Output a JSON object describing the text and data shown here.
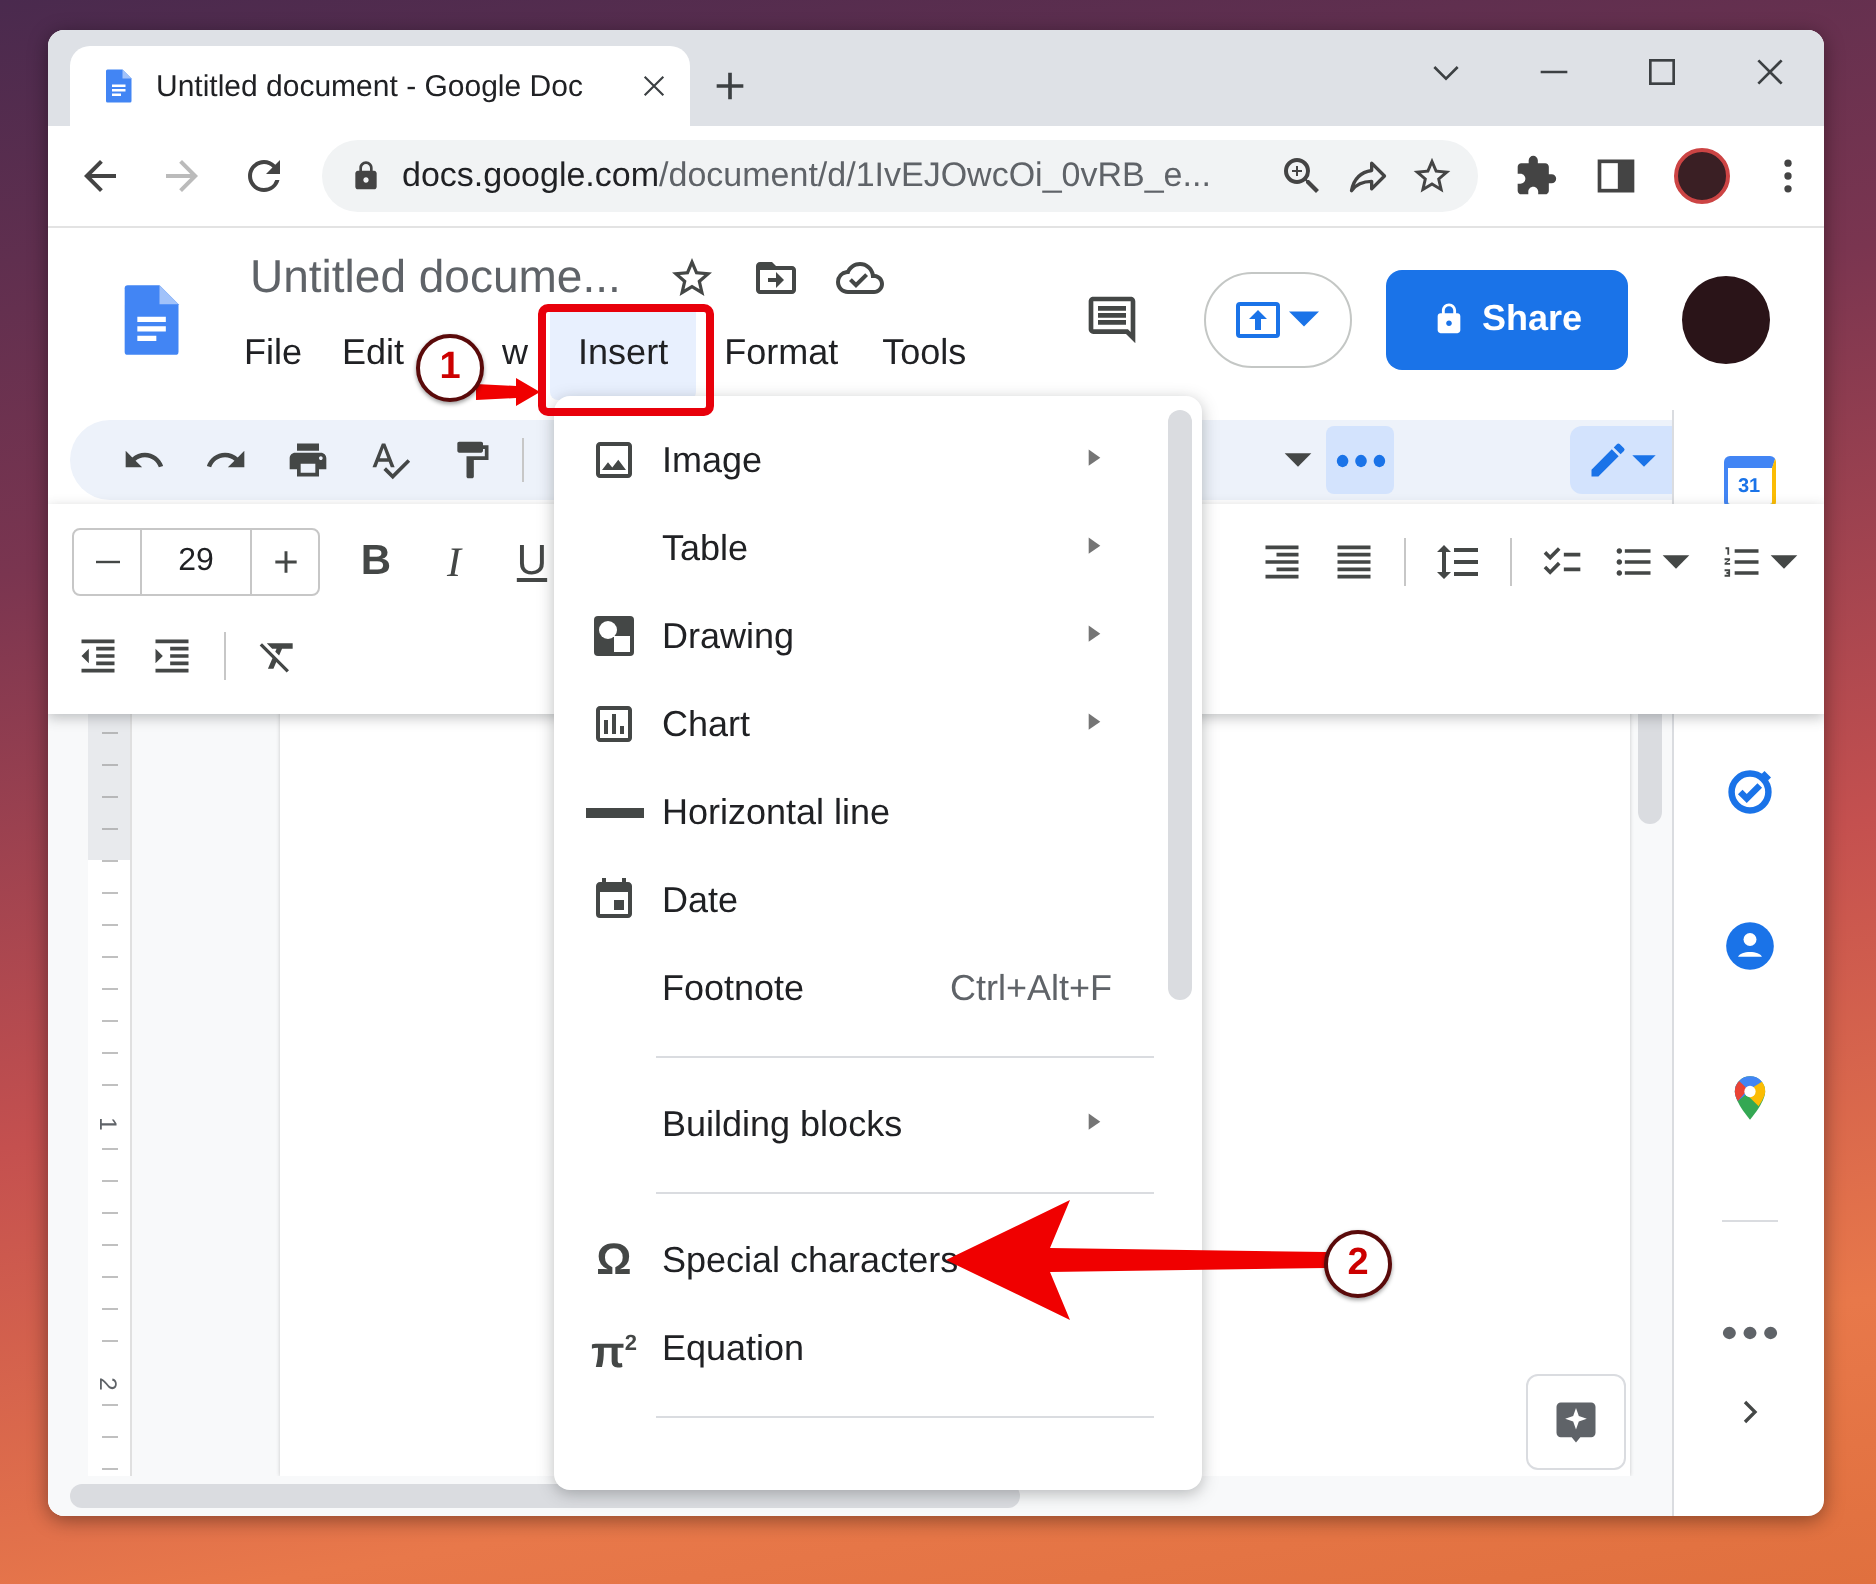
{
  "browser": {
    "tab_title": "Untitled document - Google Doc",
    "address": {
      "host": "docs.google.com",
      "path": "/document/d/1IvEJOwcOi_0vRB_e..."
    }
  },
  "doc_header": {
    "title": "Untitled docume...",
    "menu": [
      {
        "label": "File",
        "selected": false
      },
      {
        "label": "Edit",
        "selected": false
      },
      {
        "label": "w",
        "selected": false
      },
      {
        "label": "Insert",
        "selected": true
      },
      {
        "label": "Format",
        "selected": false
      },
      {
        "label": "Tools",
        "selected": false
      }
    ],
    "share_button": "Share"
  },
  "format_toolbar": {
    "font_size": "29",
    "style_buttons": [
      {
        "label": "B",
        "kind": "bold"
      },
      {
        "label": "I",
        "kind": "italic"
      },
      {
        "label": "U",
        "kind": "underline"
      }
    ]
  },
  "ruler": {
    "labels": [
      "1",
      "2"
    ]
  },
  "side_panel": {
    "calendar_day": "31"
  },
  "insert_menu": {
    "items": [
      {
        "kind": "item",
        "label": "Image",
        "submenu": true
      },
      {
        "kind": "item",
        "label": "Table",
        "submenu": true
      },
      {
        "kind": "item",
        "label": "Drawing",
        "submenu": true
      },
      {
        "kind": "item",
        "label": "Chart",
        "submenu": true
      },
      {
        "kind": "item",
        "label": "Horizontal line",
        "submenu": false
      },
      {
        "kind": "item",
        "label": "Date",
        "submenu": false
      },
      {
        "kind": "item",
        "label": "Footnote",
        "submenu": false,
        "shortcut": "Ctrl+Alt+F"
      },
      {
        "kind": "separator"
      },
      {
        "kind": "item",
        "label": "Building blocks",
        "submenu": true
      },
      {
        "kind": "separator"
      },
      {
        "kind": "item",
        "label": "Special characters",
        "submenu": false,
        "glyph": "Ω"
      },
      {
        "kind": "item",
        "label": "Equation",
        "submenu": false,
        "glyph": "π$^{2}$"
      },
      {
        "kind": "separator"
      }
    ]
  },
  "annotations": [
    {
      "number": "1"
    },
    {
      "number": "2"
    }
  ]
}
